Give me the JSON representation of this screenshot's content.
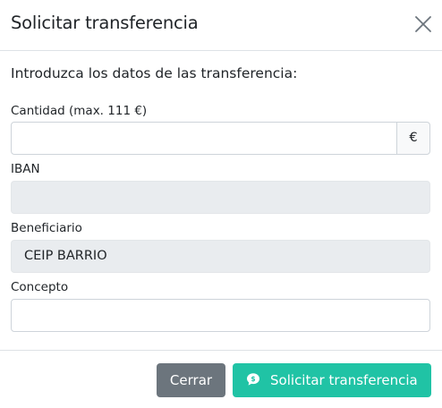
{
  "modal": {
    "title": "Solicitar transferencia",
    "intro": "Introduzca los datos de las transferencia:"
  },
  "form": {
    "amount": {
      "label": "Cantidad (max. 111 €)",
      "value": "",
      "addon": "€"
    },
    "iban": {
      "label": "IBAN",
      "value": ""
    },
    "beneficiary": {
      "label": "Beneficiario",
      "value": "CEIP BARRIO"
    },
    "concept": {
      "label": "Concepto",
      "value": ""
    }
  },
  "footer": {
    "close_label": "Cerrar",
    "submit_label": "Solicitar transferencia",
    "submit_icon": "message-dollar-icon"
  },
  "colors": {
    "primary": "#20c3a5",
    "secondary": "#6c757d",
    "readonly_bg": "#e9ecef"
  }
}
